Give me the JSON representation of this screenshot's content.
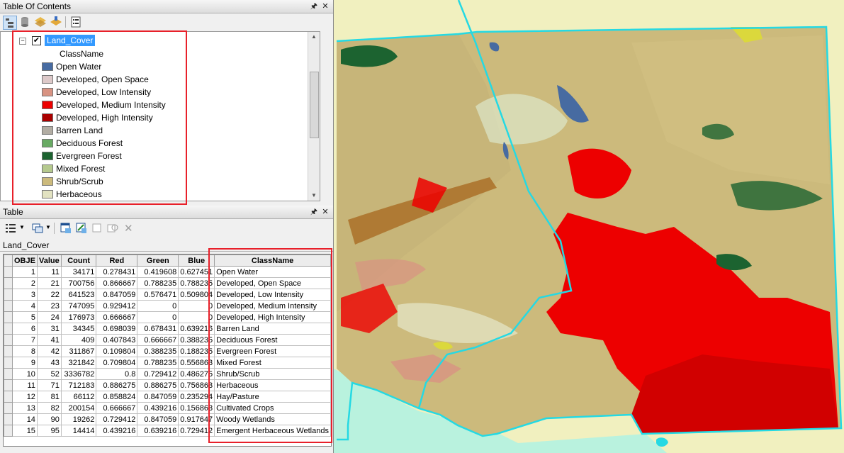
{
  "toc": {
    "title": "Table Of Contents",
    "layer_name": "Land_Cover",
    "field_label": "ClassName",
    "legend": [
      {
        "label": "Open Water",
        "color": "#476ba1"
      },
      {
        "label": "Developed, Open Space",
        "color": "#ddc9c9"
      },
      {
        "label": "Developed, Low Intensity",
        "color": "#d89382"
      },
      {
        "label": "Developed, Medium Intensity",
        "color": "#ed0000"
      },
      {
        "label": "Developed, High Intensity",
        "color": "#aa0000"
      },
      {
        "label": "Barren Land",
        "color": "#b2ada3"
      },
      {
        "label": "Deciduous Forest",
        "color": "#68aa63"
      },
      {
        "label": "Evergreen Forest",
        "color": "#1c6330"
      },
      {
        "label": "Mixed Forest",
        "color": "#b5c98e"
      },
      {
        "label": "Shrub/Scrub",
        "color": "#ccba7c"
      },
      {
        "label": "Herbaceous",
        "color": "#e2e2c1"
      }
    ]
  },
  "table_window": {
    "title": "Table",
    "tab": "Land_Cover",
    "columns": [
      "OBJE",
      "Value",
      "Count",
      "Red",
      "Green",
      "Blue",
      "ClassName"
    ],
    "rows": [
      [
        "1",
        "11",
        "34171",
        "0.278431",
        "0.419608",
        "0.627451",
        "Open Water"
      ],
      [
        "2",
        "21",
        "700756",
        "0.866667",
        "0.788235",
        "0.788235",
        "Developed, Open Space"
      ],
      [
        "3",
        "22",
        "641523",
        "0.847059",
        "0.576471",
        "0.509804",
        "Developed, Low Intensity"
      ],
      [
        "4",
        "23",
        "747095",
        "0.929412",
        "0",
        "0",
        "Developed, Medium Intensity"
      ],
      [
        "5",
        "24",
        "176973",
        "0.666667",
        "0",
        "0",
        "Developed, High Intensity"
      ],
      [
        "6",
        "31",
        "34345",
        "0.698039",
        "0.678431",
        "0.639216",
        "Barren Land"
      ],
      [
        "7",
        "41",
        "409",
        "0.407843",
        "0.666667",
        "0.388235",
        "Deciduous Forest"
      ],
      [
        "8",
        "42",
        "311867",
        "0.109804",
        "0.388235",
        "0.188235",
        "Evergreen Forest"
      ],
      [
        "9",
        "43",
        "321842",
        "0.709804",
        "0.788235",
        "0.556863",
        "Mixed Forest"
      ],
      [
        "10",
        "52",
        "3336782",
        "0.8",
        "0.729412",
        "0.486275",
        "Shrub/Scrub"
      ],
      [
        "11",
        "71",
        "712183",
        "0.886275",
        "0.886275",
        "0.756863",
        "Herbaceous"
      ],
      [
        "12",
        "81",
        "66112",
        "0.858824",
        "0.847059",
        "0.235294",
        "Hay/Pasture"
      ],
      [
        "13",
        "82",
        "200154",
        "0.666667",
        "0.439216",
        "0.156863",
        "Cultivated Crops"
      ],
      [
        "14",
        "90",
        "19262",
        "0.729412",
        "0.847059",
        "0.917647",
        "Woody Wetlands"
      ],
      [
        "15",
        "95",
        "14414",
        "0.439216",
        "0.639216",
        "0.729412",
        "Emergent Herbaceous Wetlands"
      ]
    ]
  },
  "colors": {
    "highlight_box": "#e8202a",
    "map_boundary": "#25d9e3",
    "map_background": "#f1f0bf",
    "ocean": "#b9f2de"
  },
  "icons": [
    "pin-icon",
    "close-icon",
    "list-by-drawing-order-icon",
    "list-by-source-icon",
    "list-by-visibility-icon",
    "list-by-selection-icon",
    "options-icon",
    "table-options-icon",
    "related-tables-icon",
    "select-by-attributes-icon",
    "switch-selection-icon",
    "clear-selection-icon",
    "zoom-to-selected-icon",
    "delete-selected-icon"
  ]
}
